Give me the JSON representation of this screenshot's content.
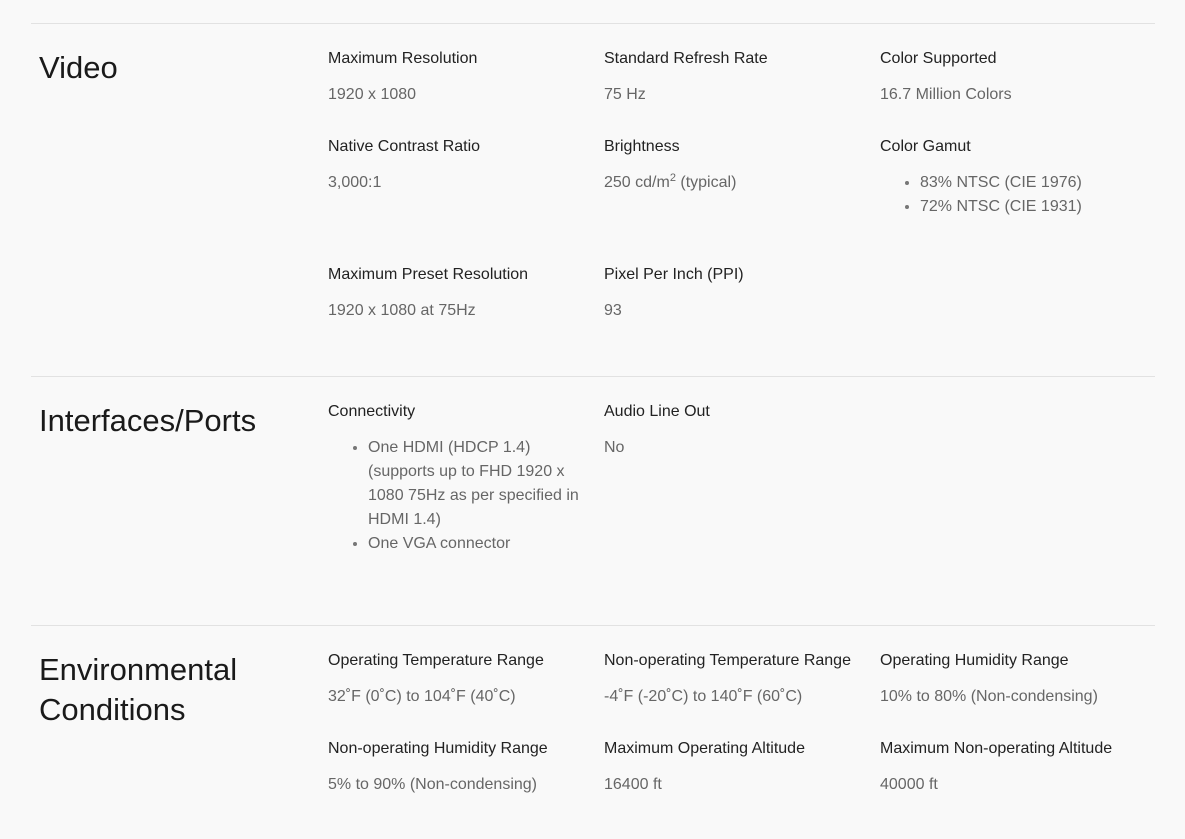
{
  "video": {
    "title": "Video",
    "max_resolution": {
      "label": "Maximum Resolution",
      "value": "1920 x 1080"
    },
    "refresh_rate": {
      "label": "Standard Refresh Rate",
      "value": "75 Hz"
    },
    "color_supported": {
      "label": "Color Supported",
      "value": "16.7 Million Colors"
    },
    "contrast_ratio": {
      "label": "Native Contrast Ratio",
      "value": "3,000:1"
    },
    "brightness": {
      "label": "Brightness",
      "value_prefix": "250 cd/m",
      "value_sup": "2",
      "value_suffix": " (typical)"
    },
    "color_gamut": {
      "label": "Color Gamut",
      "items": [
        "83% NTSC (CIE 1976)",
        "72% NTSC (CIE 1931)"
      ]
    },
    "max_preset_resolution": {
      "label": "Maximum Preset Resolution",
      "value": "1920 x 1080 at 75Hz"
    },
    "ppi": {
      "label": "Pixel Per Inch (PPI)",
      "value": "93"
    }
  },
  "interfaces": {
    "title": "Interfaces/Ports",
    "connectivity": {
      "label": "Connectivity",
      "items": [
        "One HDMI (HDCP 1.4) (supports up to FHD 1920 x 1080 75Hz as per specified in HDMI 1.4)",
        "One VGA connector"
      ]
    },
    "audio_line_out": {
      "label": "Audio Line Out",
      "value": "No"
    }
  },
  "environmental": {
    "title_line1": "Environmental",
    "title_line2": "Conditions",
    "op_temp": {
      "label": "Operating Temperature Range",
      "value": "32˚F (0˚C) to 104˚F (40˚C)"
    },
    "nonop_temp": {
      "label": "Non-operating Temperature Range",
      "value": "-4˚F (-20˚C) to 140˚F (60˚C)"
    },
    "op_humidity": {
      "label": "Operating Humidity Range",
      "value": "10% to 80% (Non-condensing)"
    },
    "nonop_humidity": {
      "label": "Non-operating Humidity Range",
      "value": "5% to 90% (Non-condensing)"
    },
    "op_altitude": {
      "label": "Maximum Operating Altitude",
      "value": "16400 ft"
    },
    "nonop_altitude": {
      "label": "Maximum Non-operating Altitude",
      "value": "40000 ft"
    }
  }
}
